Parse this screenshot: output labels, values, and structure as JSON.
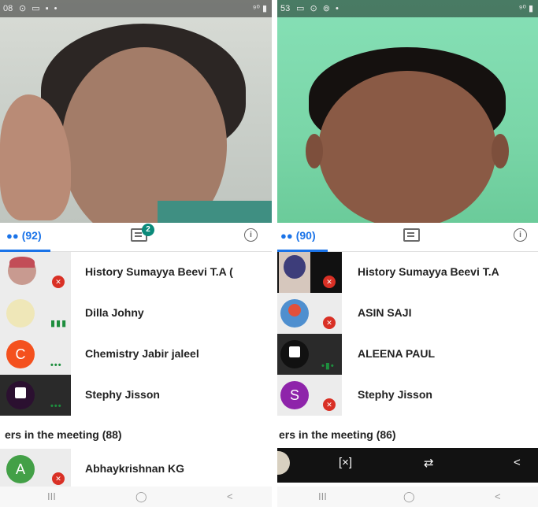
{
  "left": {
    "status": {
      "time": "08",
      "icons": "⊙ ▭ ▪ •",
      "net": "⁹⁰ ▮"
    },
    "tabs": {
      "people_count": "(92)",
      "chat_badge": "2"
    },
    "participants": [
      {
        "name": "History Sumayya Beevi T.A (",
        "muted": true
      },
      {
        "name": "Dilla Johny",
        "speaking": true
      },
      {
        "name": "Chemistry Jabir jaleel",
        "avatar_letter": "C",
        "avatar_color": "#f4511e"
      },
      {
        "name": "Stephy Jisson",
        "pinned": true
      }
    ],
    "section_label": "ers in the meeting (88)",
    "others": [
      {
        "name": "Abhaykrishnan KG",
        "avatar_letter": "A",
        "avatar_color": "#43a047",
        "muted": true
      }
    ],
    "nav": {
      "recent": "III",
      "home": "◯",
      "back": "<"
    }
  },
  "right": {
    "status": {
      "time": "53",
      "icons": "▭ ⊙ ⊚ •",
      "net": "⁹⁰ ▮"
    },
    "tabs": {
      "people_count": "(90)"
    },
    "participants": [
      {
        "name": "History Sumayya Beevi T.A",
        "muted": true
      },
      {
        "name": "ASIN SAJI",
        "muted": true
      },
      {
        "name": "ALEENA PAUL",
        "pinned": true,
        "speaking": true
      },
      {
        "name": "Stephy Jisson",
        "avatar_letter": "S",
        "avatar_color": "#8e24aa",
        "muted": true
      }
    ],
    "section_label": "ers in the meeting (86)",
    "nav": {
      "recent": "III",
      "home": "◯",
      "back": "<"
    }
  },
  "icons": {
    "people": "people-icon",
    "chat": "chat-icon",
    "info": "info-icon",
    "mic_off": "mic-off-icon",
    "pin": "pin-icon"
  }
}
